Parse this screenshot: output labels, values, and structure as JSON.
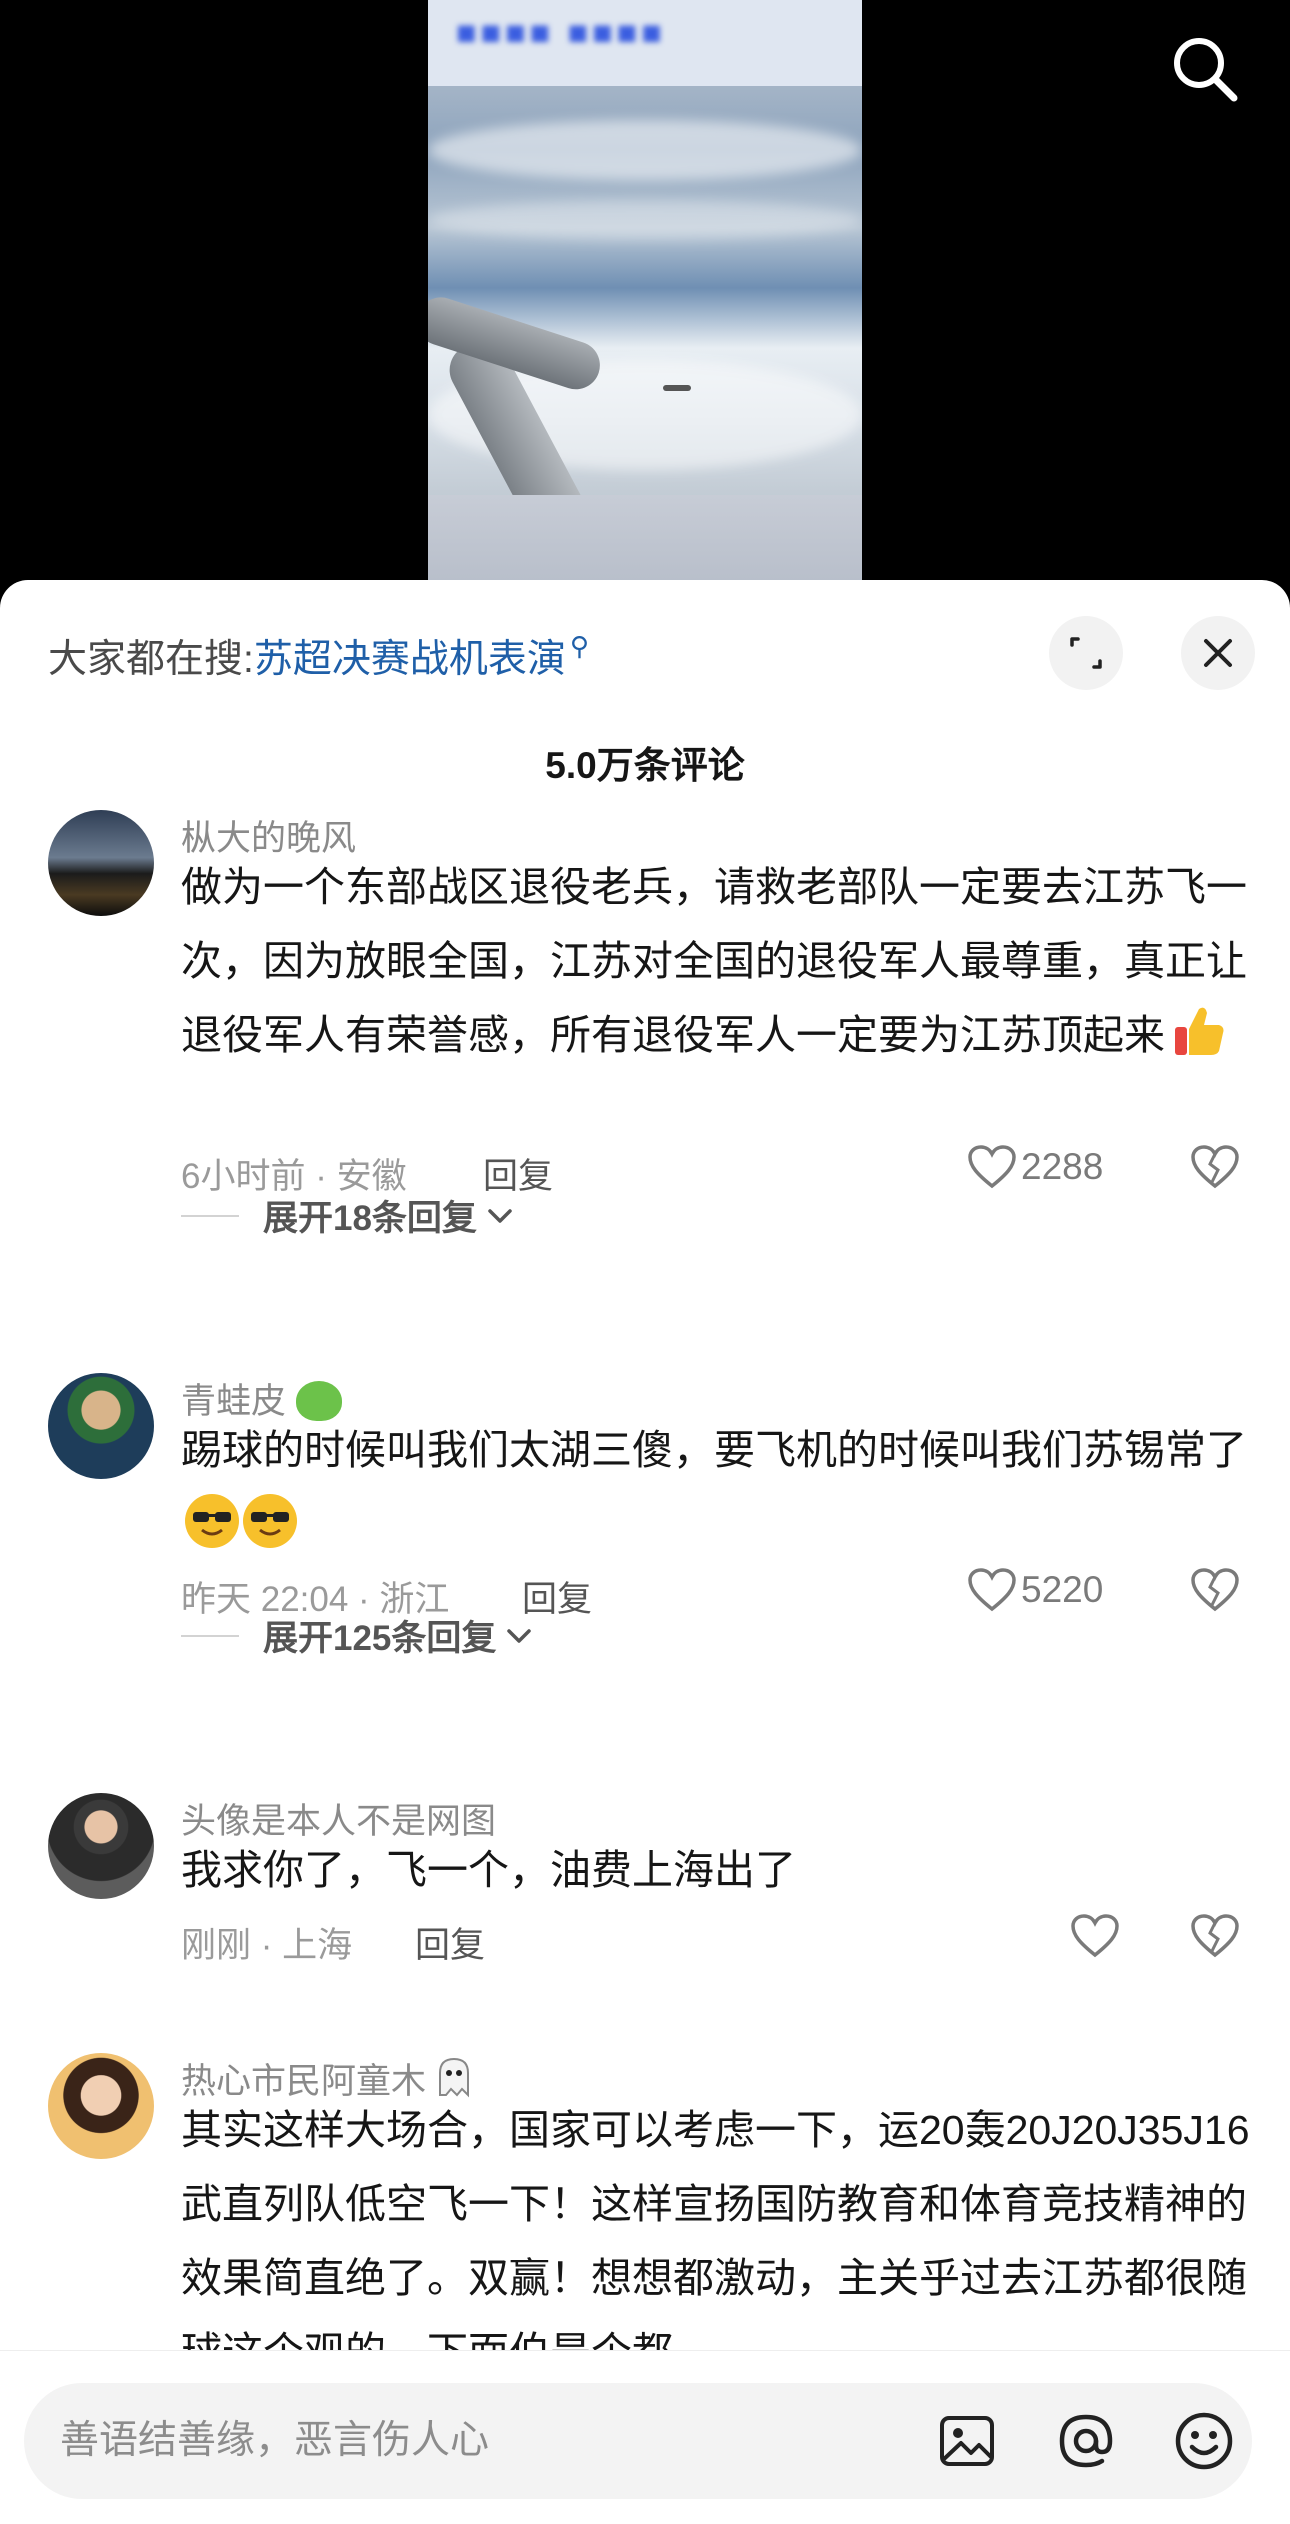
{
  "video": {
    "banner_text": "■■■■ ■■■■"
  },
  "sheet": {
    "search_prefix": "大家都在搜:",
    "search_keyword": "苏超决赛战机表演",
    "comment_count": "5.0万条评论"
  },
  "comments": [
    {
      "username": "枞大的晚风",
      "text": "做为一个东部战区退役老兵，请救老部队一定要去江苏飞一次，因为放眼全国，江苏对全国的退役军人最尊重，真正让退役军人有荣誉感，所有退役军人一定要为江苏顶起来",
      "time_location": "6小时前 · 安徽",
      "reply_label": "回复",
      "likes": "2288",
      "expand_label": "展开18条回复",
      "emoji": "thumbs-up"
    },
    {
      "username": "青蛙皮",
      "text": "踢球的时候叫我们太湖三傻，要飞机的时候叫我们苏锡常了",
      "time_location": "昨天 22:04 · 浙江",
      "reply_label": "回复",
      "likes": "5220",
      "expand_label": "展开125条回复",
      "emoji": "cool-face"
    },
    {
      "username": "头像是本人不是网图",
      "text": "我求你了，飞一个，油费上海出了",
      "time_location": "刚刚 · 上海",
      "reply_label": "回复",
      "likes": ""
    },
    {
      "username": "热心市民阿童木",
      "text": "其实这样大场合，国家可以考虑一下，运20轰20J20J35J16武直列队低空飞一下！这样宣扬国防教育和体育竞技精神的效果简直绝了。双赢！想想都激动，主关乎过去江苏都很随球这个观的，下面伯是个都"
    }
  ],
  "input": {
    "placeholder": "善语结善缘，恶言伤人心"
  },
  "colors": {
    "keyword": "#1f5fa8",
    "text": "#161616",
    "meta": "#9a9a9a"
  }
}
